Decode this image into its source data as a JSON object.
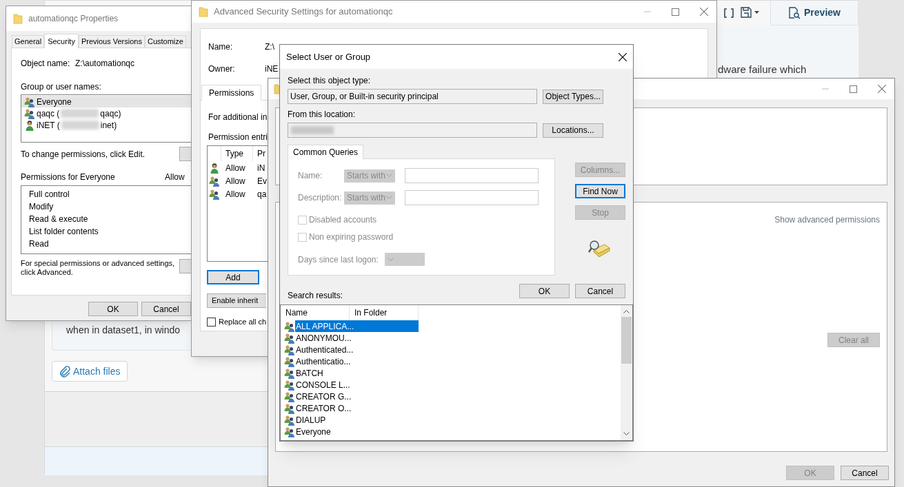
{
  "background_app": {
    "preview_button": "Preview",
    "description_fragment": "dware failure which",
    "comment_fragment": "when in dataset1, in windo",
    "attach_button": "Attach files"
  },
  "properties_window": {
    "title": "automationqc Properties",
    "tabs": [
      {
        "label": "General",
        "selected": false
      },
      {
        "label": "Security",
        "selected": true
      },
      {
        "label": "Previous Versions",
        "selected": false
      },
      {
        "label": "Customize",
        "selected": false
      }
    ],
    "object_name_label": "Object name:",
    "object_name": "Z:\\automationqc",
    "group_label": "Group or user names:",
    "principals": [
      {
        "kind": "group",
        "name": "Everyone",
        "redacted": false,
        "selected": true
      },
      {
        "kind": "group",
        "name": "qaqc (",
        "redacted": true,
        "name_tail": "qaqc)",
        "selected": false
      },
      {
        "kind": "user",
        "name": "iNET (",
        "redacted": true,
        "name_tail": "inet)",
        "selected": false
      }
    ],
    "edit_hint": "To change permissions, click Edit.",
    "permissions_label": "Permissions for Everyone",
    "allow_header": "Allow",
    "permissions": [
      "Full control",
      "Modify",
      "Read & execute",
      "List folder contents",
      "Read"
    ],
    "advanced_hint": "For special permissions or advanced settings, click Advanced.",
    "buttons": [
      "OK",
      "Cancel"
    ]
  },
  "advanced_window": {
    "title": "Advanced Security Settings for automationqc",
    "name_label": "Name:",
    "name_value": "Z:\\",
    "owner_label": "Owner:",
    "owner_value": "iNE",
    "tabs": [
      {
        "label": "Permissions",
        "selected": true
      }
    ],
    "info_text": "For additional in",
    "entries_label": "Permission entri",
    "columns": [
      "Type",
      "Pr"
    ],
    "entries": [
      {
        "kind": "user",
        "type": "Allow",
        "principal": "iN"
      },
      {
        "kind": "group",
        "type": "Allow",
        "principal": "Ev"
      },
      {
        "kind": "group",
        "type": "Allow",
        "principal": "qa"
      }
    ],
    "add_button": {
      "label": "Add",
      "focused": true
    },
    "inherit_button": "Enable inherit",
    "replace_checkbox": {
      "label": "Replace all ch",
      "checked": false
    }
  },
  "permissions_window": {
    "advanced_link": "Show advanced permissions",
    "clear_button": {
      "label": "Clear all",
      "disabled": true
    },
    "buttons": [
      {
        "label": "OK",
        "disabled": true
      },
      {
        "label": "Cancel",
        "disabled": false
      }
    ]
  },
  "select_dialog": {
    "title": "Select User or Group",
    "object_type_label": "Select this object type:",
    "object_type": "User, Group, or Built-in security principal",
    "object_types_button": "Object Types...",
    "location_label": "From this location:",
    "location_redacted": true,
    "locations_button": "Locations...",
    "queries_tab": {
      "label": "Common Queries",
      "selected": true
    },
    "queries_disabled": true,
    "query_fields": [
      {
        "label": "Name:",
        "match": "Starts with"
      },
      {
        "label": "Description:",
        "match": "Starts with"
      }
    ],
    "checkboxes": [
      {
        "label": "Disabled accounts",
        "checked": false
      },
      {
        "label": "Non expiring password",
        "checked": false
      }
    ],
    "days_label": "Days since last logon:",
    "side_buttons": [
      {
        "label": "Columns...",
        "disabled": true,
        "focused": false
      },
      {
        "label": "Find Now",
        "disabled": false,
        "focused": true
      },
      {
        "label": "Stop",
        "disabled": true,
        "focused": false
      }
    ],
    "buttons": [
      "OK",
      "Cancel"
    ],
    "results_label": "Search results:",
    "columns": [
      "Name",
      "In Folder"
    ],
    "results": [
      {
        "name": "ALL APPLICA...",
        "selected": true
      },
      {
        "name": "ANONYMOU...",
        "selected": false
      },
      {
        "name": "Authenticated...",
        "selected": false
      },
      {
        "name": "Authenticatio...",
        "selected": false
      },
      {
        "name": "BATCH",
        "selected": false
      },
      {
        "name": "CONSOLE L...",
        "selected": false
      },
      {
        "name": "CREATOR G...",
        "selected": false
      },
      {
        "name": "CREATOR O...",
        "selected": false
      },
      {
        "name": "DIALUP",
        "selected": false
      },
      {
        "name": "Everyone",
        "selected": false
      }
    ]
  }
}
